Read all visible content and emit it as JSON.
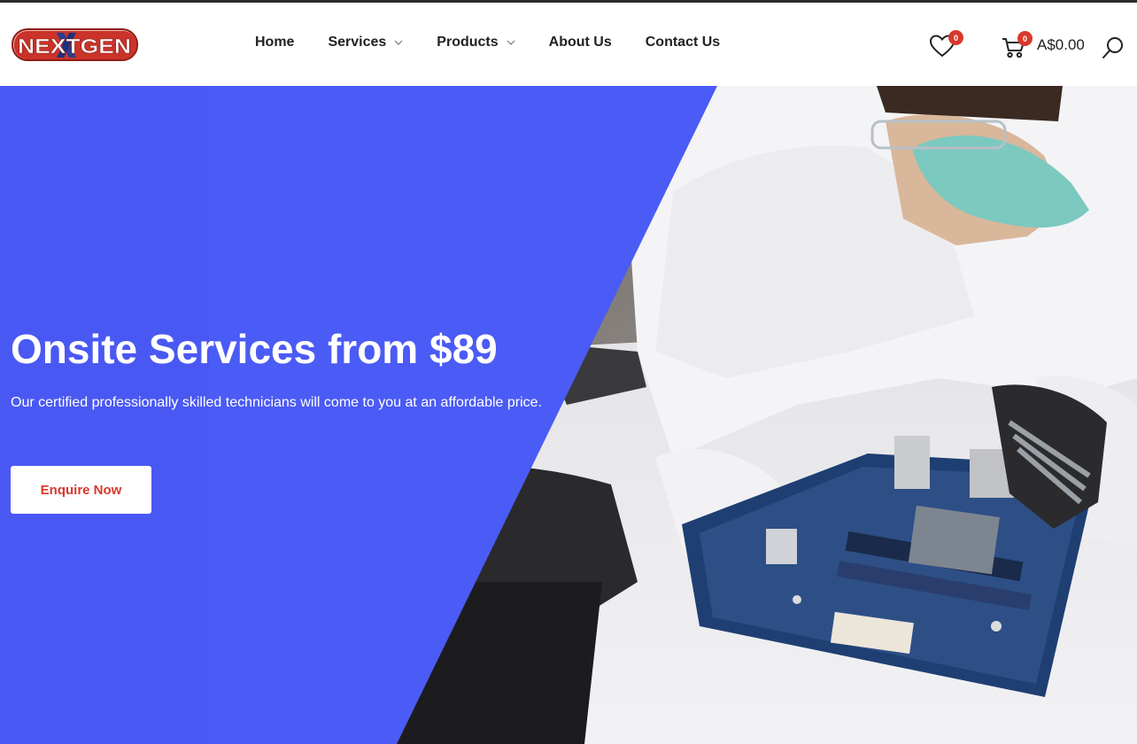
{
  "brand": {
    "logo_text": "NEXTGEN"
  },
  "nav": {
    "home": "Home",
    "services": "Services",
    "products": "Products",
    "about": "About Us",
    "contact": "Contact Us"
  },
  "header_actions": {
    "wishlist_count": "0",
    "cart_count": "0",
    "cart_total": "A$0.00"
  },
  "hero": {
    "title": "Onsite Services from $89",
    "subtitle": "Our certified professionally skilled technicians will come to you at an affordable price.",
    "cta_label": "Enquire Now"
  },
  "colors": {
    "hero_blue": "#4b5bf5",
    "accent_red": "#d8382c",
    "nav_text": "#222222"
  },
  "icons": [
    "heart-icon",
    "cart-icon",
    "search-icon",
    "chevron-down-icon"
  ]
}
